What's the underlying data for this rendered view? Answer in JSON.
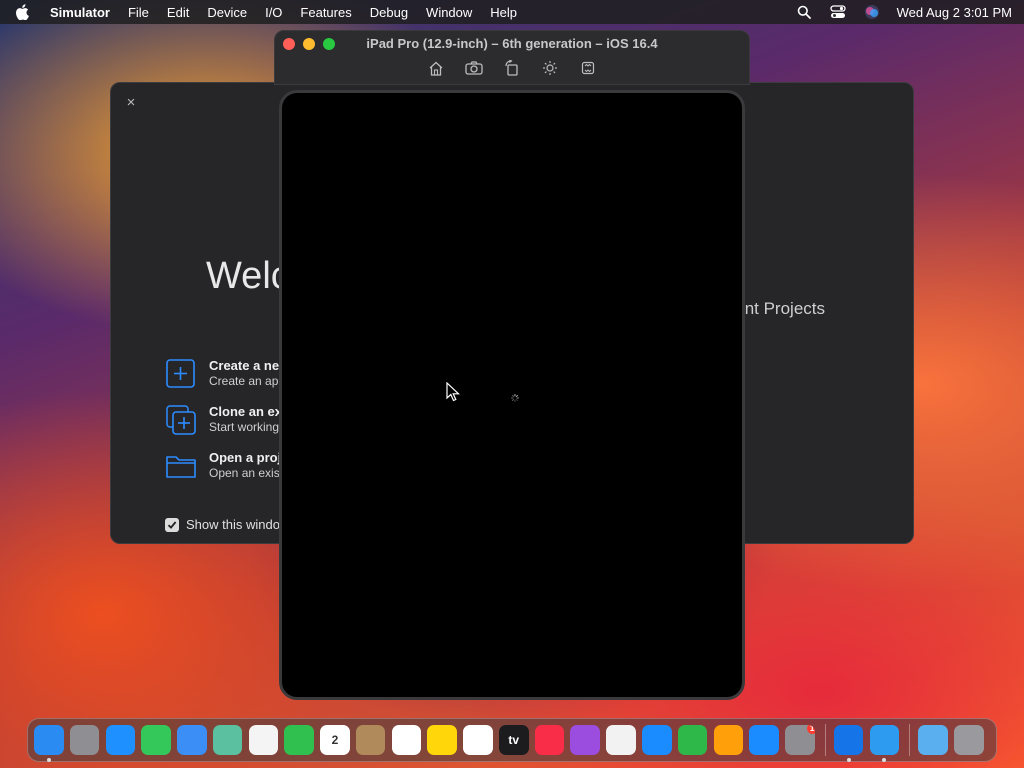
{
  "menubar": {
    "app_name": "Simulator",
    "items": [
      "File",
      "Edit",
      "Device",
      "I/O",
      "Features",
      "Debug",
      "Window",
      "Help"
    ],
    "clock": "Wed Aug 2  3:01 PM"
  },
  "welcome": {
    "close": "×",
    "title": "Welcome to Xcode",
    "recent_label": "No Recent Projects",
    "actions": [
      {
        "title": "Create a new Xcode project",
        "subtitle": "Create an app for iPhone, iPad, Mac, Apple Watch, or Apple TV."
      },
      {
        "title": "Clone an existing project",
        "subtitle": "Start working on something from a Git repository."
      },
      {
        "title": "Open a project or file",
        "subtitle": "Open an existing project or file on your Mac."
      }
    ],
    "show_again_label": "Show this window when Xcode launches",
    "show_again_checked": true
  },
  "simulator": {
    "window_title": "iPad Pro (12.9-inch) – 6th generation – iOS 16.4",
    "tools": [
      "home-icon",
      "screenshot-icon",
      "rotate-icon",
      "appearance-icon",
      "shake-icon"
    ]
  },
  "dock": {
    "apps": [
      {
        "name": "Finder",
        "color": "#2a8bf2",
        "label": "",
        "running": true
      },
      {
        "name": "Launchpad",
        "color": "#8e8e93",
        "label": "",
        "running": false
      },
      {
        "name": "Safari",
        "color": "#1e90ff",
        "label": "",
        "running": false
      },
      {
        "name": "Messages",
        "color": "#34c759",
        "label": "",
        "running": false
      },
      {
        "name": "Mail",
        "color": "#3a8ef6",
        "label": "",
        "running": false
      },
      {
        "name": "Maps",
        "color": "#5bc0a0",
        "label": "",
        "running": false
      },
      {
        "name": "Photos",
        "color": "#f4f4f4",
        "label": "",
        "running": false
      },
      {
        "name": "FaceTime",
        "color": "#30c04f",
        "label": "",
        "running": false
      },
      {
        "name": "Calendar",
        "color": "#ffffff",
        "label": "2",
        "running": false
      },
      {
        "name": "Contacts",
        "color": "#b08a5a",
        "label": "",
        "running": false
      },
      {
        "name": "Reminders",
        "color": "#ffffff",
        "label": "",
        "running": false
      },
      {
        "name": "Notes",
        "color": "#ffd60a",
        "label": "",
        "running": false
      },
      {
        "name": "Freeform",
        "color": "#ffffff",
        "label": "",
        "running": false
      },
      {
        "name": "TV",
        "color": "#1c1c1e",
        "label": "tv",
        "running": false
      },
      {
        "name": "Music",
        "color": "#fa2d48",
        "label": "",
        "running": false
      },
      {
        "name": "Podcasts",
        "color": "#9b4de0",
        "label": "",
        "running": false
      },
      {
        "name": "News",
        "color": "#f2f2f2",
        "label": "",
        "running": false
      },
      {
        "name": "Keynote",
        "color": "#1a8cff",
        "label": "",
        "running": false
      },
      {
        "name": "Numbers",
        "color": "#2fb84a",
        "label": "",
        "running": false
      },
      {
        "name": "Pages",
        "color": "#ff9f0a",
        "label": "",
        "running": false
      },
      {
        "name": "App Store",
        "color": "#1b8cff",
        "label": "",
        "running": false
      },
      {
        "name": "System Settings",
        "color": "#8e8e93",
        "label": "",
        "running": false,
        "badge": "1"
      }
    ],
    "recent_apps": [
      {
        "name": "Xcode",
        "color": "#1575e8",
        "running": true
      },
      {
        "name": "Simulator",
        "color": "#2d9cf0",
        "running": true
      }
    ],
    "others": [
      {
        "name": "Downloads",
        "color": "#5ab0ef"
      },
      {
        "name": "Trash",
        "color": "#9a9a9e"
      }
    ]
  }
}
